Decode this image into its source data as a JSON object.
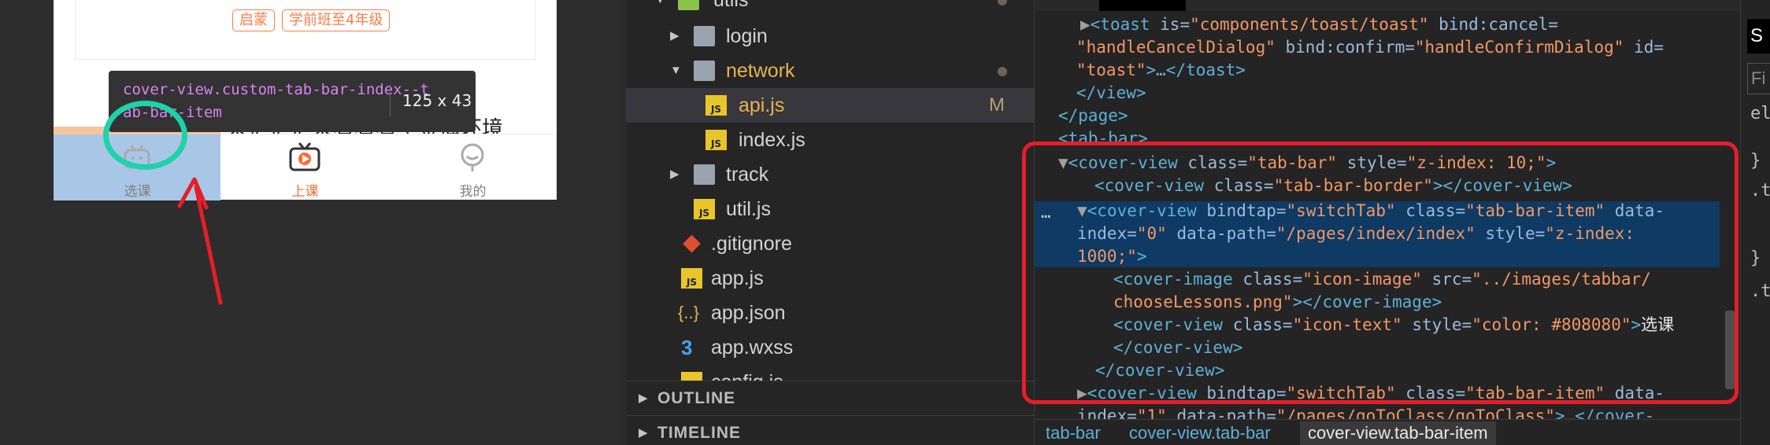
{
  "simulator": {
    "tags": [
      "启蒙",
      "学前班至4年级"
    ],
    "body_text": "已哦哦哦\n来扩扩扩来看看看了金海环境",
    "tooltip": {
      "element_name": "cover-view.custom-tab-bar-index--tab-bar-item",
      "size": "125 x 43"
    },
    "tabbar": {
      "items": [
        {
          "label": "选课",
          "icon": "choose-lessons-icon"
        },
        {
          "label": "上课",
          "icon": "tv-play-icon"
        },
        {
          "label": "我的",
          "icon": "profile-icon"
        }
      ],
      "active_color": "#ff6a2f",
      "inactive_color": "#808080"
    }
  },
  "explorer": {
    "rows": [
      {
        "name": "utils",
        "type": "folder",
        "expanded": true,
        "modified_dot": true
      },
      {
        "name": "login",
        "type": "folder",
        "expanded": false
      },
      {
        "name": "network",
        "type": "folder",
        "expanded": true,
        "modified_dot": true,
        "highlight": true
      },
      {
        "name": "api.js",
        "type": "js",
        "badge": "M",
        "selected": true
      },
      {
        "name": "index.js",
        "type": "js"
      },
      {
        "name": "track",
        "type": "folder",
        "expanded": false
      },
      {
        "name": "util.js",
        "type": "js"
      },
      {
        "name": ".gitignore",
        "type": "git"
      },
      {
        "name": "app.js",
        "type": "js"
      },
      {
        "name": "app.json",
        "type": "json"
      },
      {
        "name": "app.wxss",
        "type": "css"
      },
      {
        "name": "config.js",
        "type": "js"
      }
    ],
    "sections": [
      "OUTLINE",
      "TIMELINE"
    ]
  },
  "devtools": {
    "lines": [
      "toast_line_1",
      "toast_line_2",
      "view_close",
      "page_close",
      "tab_bar_open",
      "cover_view_tabbar",
      "tabbar_border",
      "item_0_a",
      "item_0_b",
      "item_0_c",
      "image_a",
      "image_b",
      "icon_text_a",
      "icon_text_b",
      "cover_close",
      "item_1_a",
      "item_1_b"
    ],
    "code": {
      "toast_tag": "<toast",
      "toast_attrs_1": " is=",
      "toast_is_val": "\"components/toast/toast\"",
      "toast_bindcancel": " bind:cancel=",
      "toast_cancel_val": "\"handleCancelDialog\"",
      "toast_bindconfirm": " bind:confirm=",
      "toast_confirm_val": "\"handleConfirmDialog\"",
      "toast_id": " id=",
      "toast_id_val": "\"toast\"",
      "toast_rest": ">…</toast>",
      "view_close": "</view>",
      "page_close": "</page>",
      "tab_bar_open": "<tab-bar>",
      "cv": "<cover-view",
      "cv_close": "</cover-view>",
      "class_attr": " class=",
      "style_attr": " style=",
      "tabbar_class": "\"tab-bar\"",
      "tabbar_style": "\"z-index: 10;\"",
      "border_class": "\"tab-bar-border\"",
      "bindtap": " bindtap=",
      "switchtab": "\"switchTab\"",
      "item_class": "\"tab-bar-item\"",
      "data_attr": " data-",
      "index_attr": "index=",
      "index0": "\"0\"",
      "path_attr": " data-path=",
      "path0": "\"/pages/index/index\"",
      "item_style": "\"z-index:",
      "item_style2": "1000;\"",
      "ci": "<cover-image",
      "ci_close": "</cover-image>",
      "icon_class": "\"icon-image\"",
      "src_attr": " src=",
      "src_val_a": "\"../images/tabbar/",
      "src_val_b": "chooseLessons.png\"",
      "icon_text_class": "\"icon-text\"",
      "icon_text_style": "\"color: #808080\"",
      "icon_text_content": "选课",
      "index1": "\"1\"",
      "path1": "\"/pages/goToClass/goToClass\"",
      "path1_tail": "…</cover-"
    },
    "breadcrumb": [
      "tab-bar",
      "cover-view.tab-bar",
      "cover-view.tab-bar-item"
    ]
  },
  "styles_pane": {
    "tab": "S",
    "filter": "Fi",
    "lines": [
      "el",
      "}",
      ".t",
      "}",
      ".t"
    ]
  },
  "colors": {
    "highlight_circle": "#1dd3a7",
    "arrow": "#e51e2a",
    "red_box": "#e51e2a",
    "selection": "#0e3a63"
  }
}
